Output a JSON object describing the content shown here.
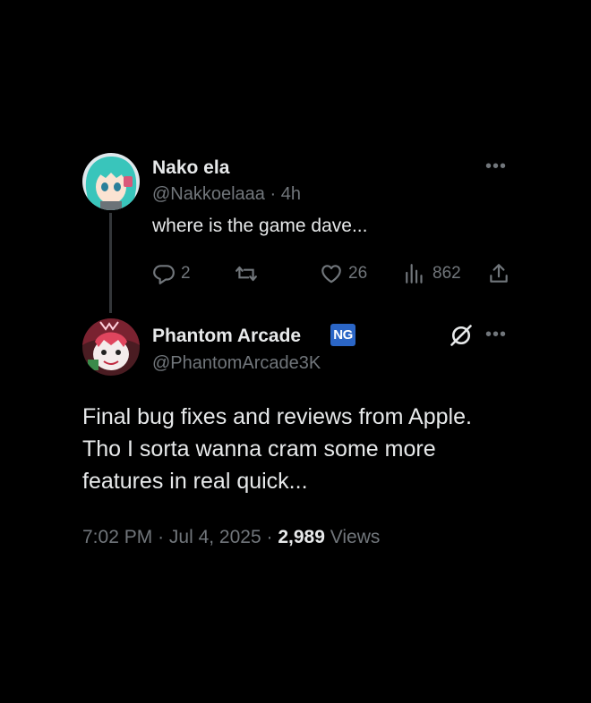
{
  "reply": {
    "author_name": "Nako ela",
    "handle": "@Nakkoelaaa",
    "separator": "·",
    "time": "4h",
    "text": "where is the game dave...",
    "stats": {
      "replies": "2",
      "reposts": "",
      "likes": "26",
      "views": "862"
    }
  },
  "main_post": {
    "author_name": "Phantom Arcade",
    "badge_text": "NG",
    "handle": "@PhantomArcade3K",
    "text": "Final bug fixes and reviews from Apple. Tho I sorta wanna cram some more features in real quick...",
    "time": "7:02 PM",
    "date": "Jul 4, 2025",
    "separator": "·",
    "views_count": "2,989",
    "views_label": "Views"
  },
  "icons": {
    "more": "more-icon",
    "reply": "reply-icon",
    "repost": "repost-icon",
    "like": "heart-icon",
    "views": "views-icon",
    "share": "share-icon",
    "grok": "grok-icon"
  },
  "colors": {
    "background": "#000000",
    "primary_text": "#e7e9ea",
    "secondary_text": "#71767b",
    "badge_bg": "#2b66c6",
    "thread_line": "#333639"
  }
}
